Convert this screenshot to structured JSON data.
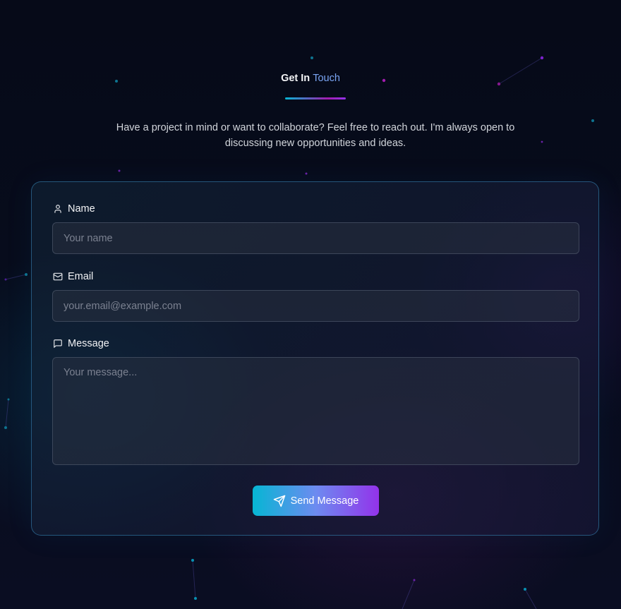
{
  "header": {
    "title_part1": "Get In",
    "title_part2": "Touch",
    "intro": "Have a project in mind or want to collaborate? Feel free to reach out. I'm always open to discussing new opportunities and ideas."
  },
  "form": {
    "name": {
      "label": "Name",
      "icon": "user-icon",
      "placeholder": "Your name",
      "value": ""
    },
    "email": {
      "label": "Email",
      "icon": "mail-icon",
      "placeholder": "your.email@example.com",
      "value": ""
    },
    "message": {
      "label": "Message",
      "icon": "message-icon",
      "placeholder": "Your message...",
      "value": ""
    },
    "submit": {
      "label": "Send Message",
      "icon": "send-icon"
    }
  },
  "colors": {
    "accent_cyan": "#06b6d4",
    "accent_purple": "#9333ea",
    "title_highlight": "#7aa5f4",
    "background": "#070c1c"
  }
}
